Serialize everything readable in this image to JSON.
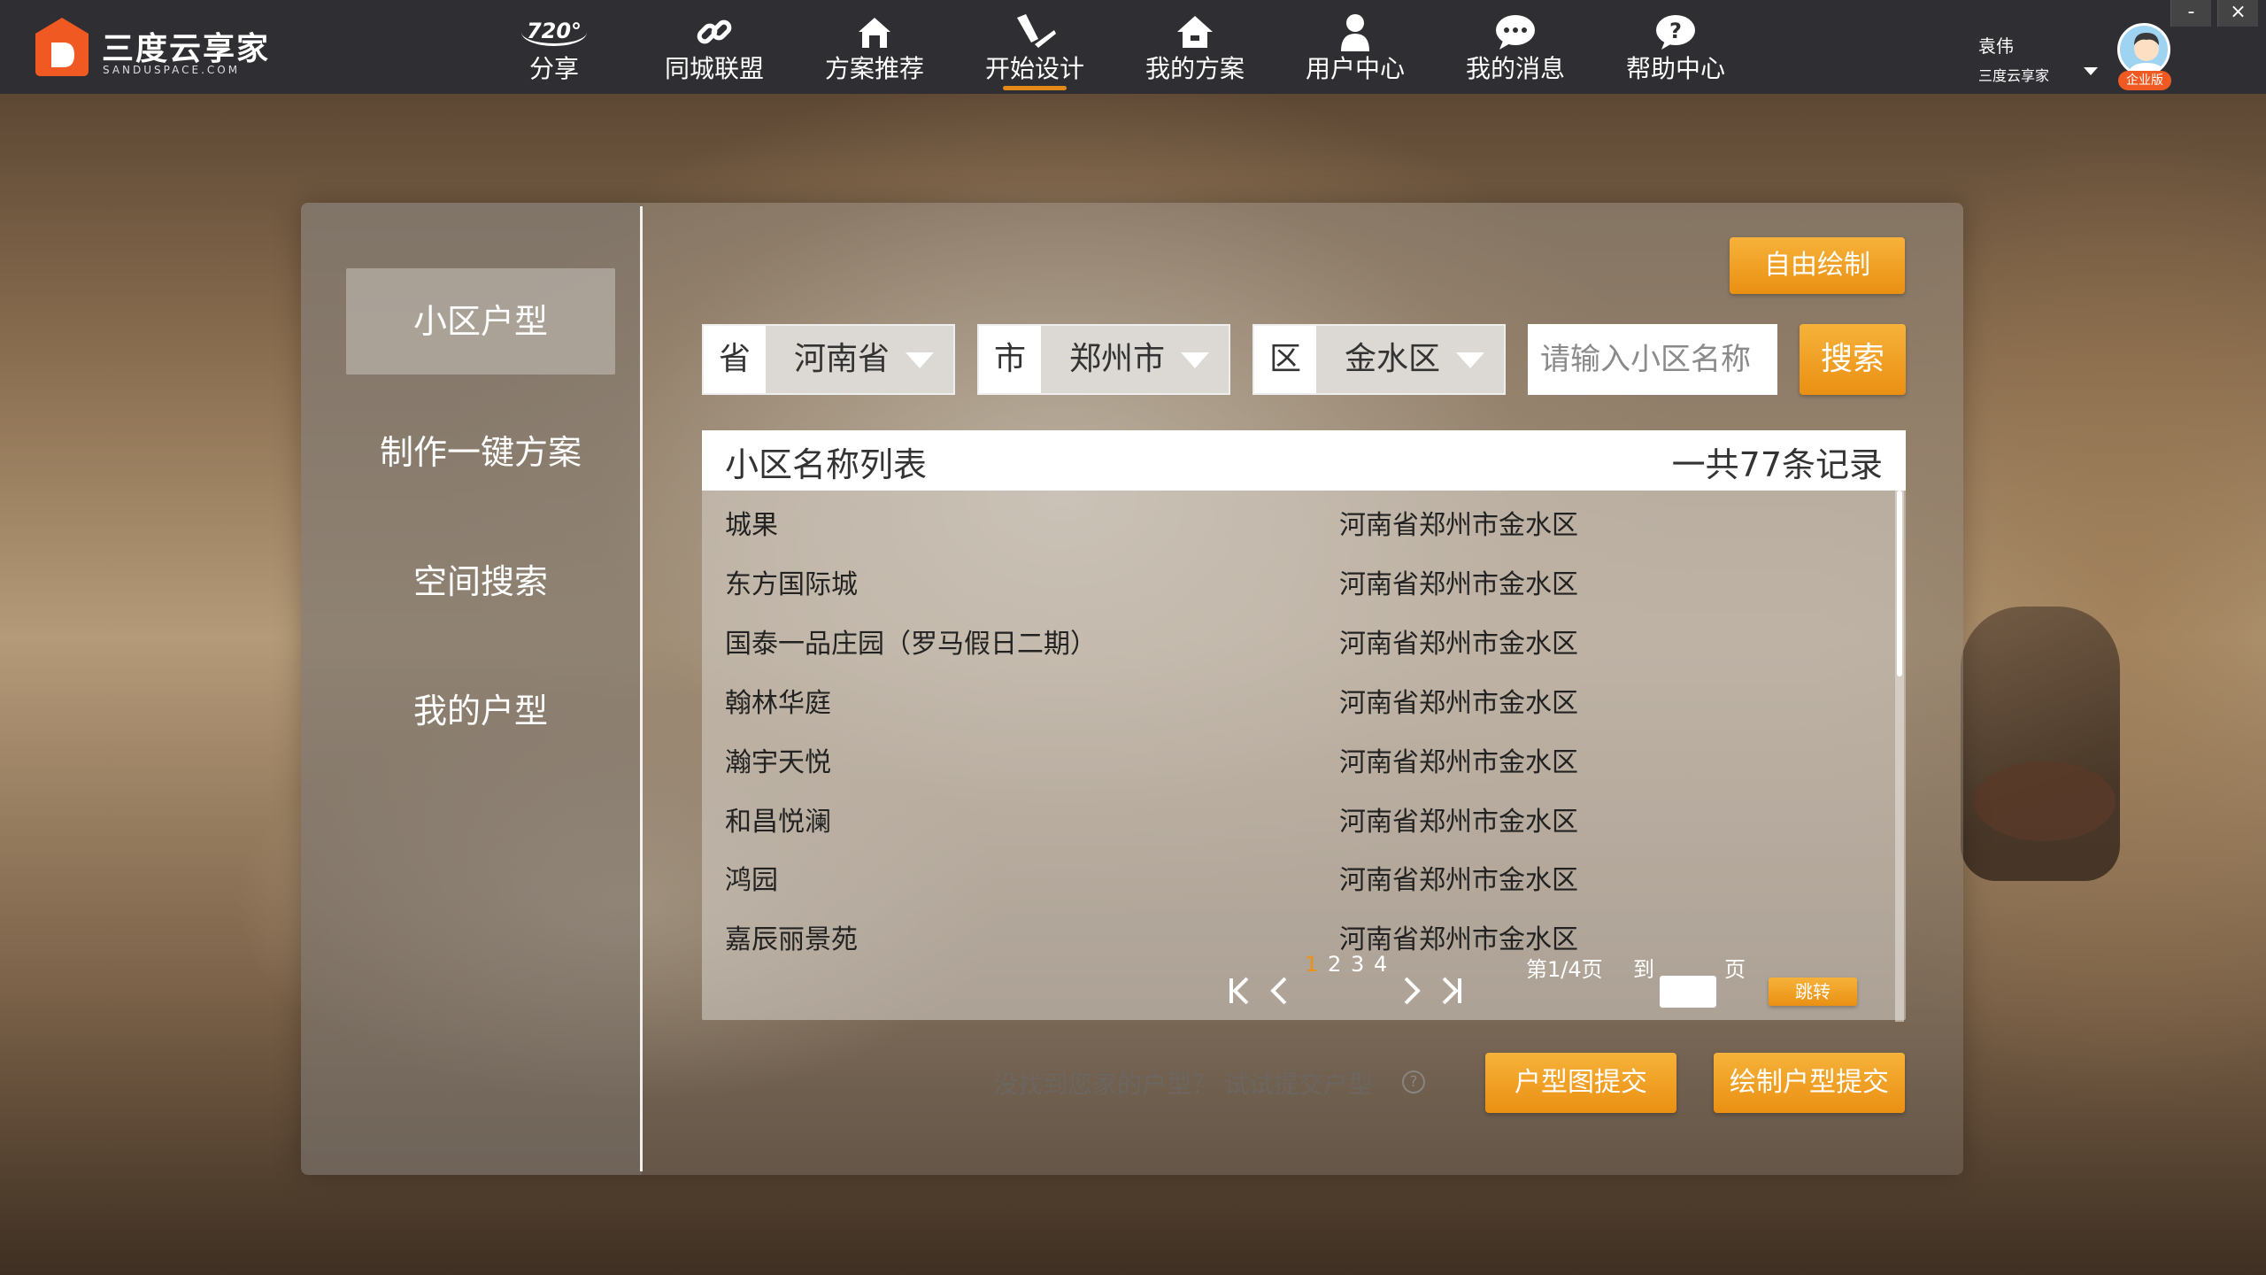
{
  "app": {
    "brand_cn": "三度云享家",
    "brand_en": "SANDUSPACE.COM",
    "accent_color": "#e58a1a"
  },
  "nav": [
    {
      "label": "分享",
      "icon": "720-share-icon"
    },
    {
      "label": "同城联盟",
      "icon": "link-icon"
    },
    {
      "label": "方案推荐",
      "icon": "house-icon"
    },
    {
      "label": "开始设计",
      "icon": "brush-ruler-icon",
      "active": true
    },
    {
      "label": "我的方案",
      "icon": "home-icon"
    },
    {
      "label": "用户中心",
      "icon": "person-icon"
    },
    {
      "label": "我的消息",
      "icon": "chat-icon"
    },
    {
      "label": "帮助中心",
      "icon": "question-chat-icon"
    }
  ],
  "user": {
    "name": "袁伟",
    "company": "三度云享家",
    "badge": "企业版"
  },
  "window": {
    "minimize": "-",
    "close": "×"
  },
  "sidebar": {
    "items": [
      "小区户型",
      "制作一键方案",
      "空间搜索",
      "我的户型"
    ],
    "active_index": 0
  },
  "toolbar": {
    "free_draw": "自由绘制",
    "search_button": "搜索",
    "search_placeholder": "请输入小区名称"
  },
  "filters": {
    "province": {
      "prefix": "省",
      "value": "河南省"
    },
    "city": {
      "prefix": "市",
      "value": "郑州市"
    },
    "district": {
      "prefix": "区",
      "value": "金水区"
    }
  },
  "list": {
    "title": "小区名称列表",
    "count": "一共77条记录",
    "rows": [
      {
        "name": "城果",
        "address": "河南省郑州市金水区"
      },
      {
        "name": "东方国际城",
        "address": "河南省郑州市金水区"
      },
      {
        "name": "国泰一品庄园（罗马假日二期）",
        "address": "河南省郑州市金水区"
      },
      {
        "name": "翰林华庭",
        "address": "河南省郑州市金水区"
      },
      {
        "name": "瀚宇天悦",
        "address": "河南省郑州市金水区"
      },
      {
        "name": "和昌悦澜",
        "address": "河南省郑州市金水区"
      },
      {
        "name": "鸿园",
        "address": "河南省郑州市金水区"
      },
      {
        "name": "嘉辰丽景苑",
        "address": "河南省郑州市金水区"
      }
    ]
  },
  "pagination": {
    "pages": [
      "1",
      "2",
      "3",
      "4"
    ],
    "current": "1",
    "page_info": "第1/4页",
    "goto_label": "到",
    "page_suffix": "页",
    "jump_button": "跳转"
  },
  "footer": {
    "help_text": "没找到您家的户型？ 试试提交户型",
    "help_icon": "?",
    "submit_plan": "户型图提交",
    "submit_draw": "绘制户型提交"
  }
}
